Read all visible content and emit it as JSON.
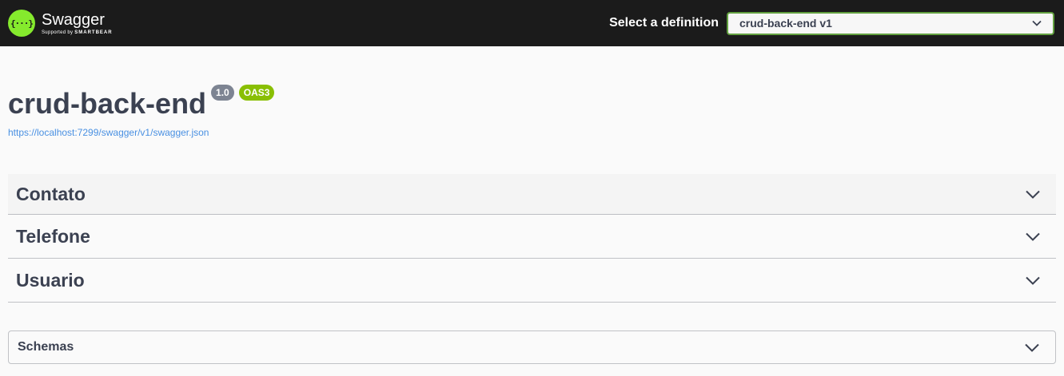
{
  "topbar": {
    "brand_name": "Swagger",
    "brand_sub_prefix": "Supported by",
    "brand_sub_name": "SMARTBEAR",
    "logo_glyph": "{···}",
    "select_label": "Select a definition",
    "selected_definition": "crud-back-end v1"
  },
  "info": {
    "title": "crud-back-end",
    "version": "1.0",
    "oas_badge": "OAS3",
    "spec_url": "https://localhost:7299/swagger/v1/swagger.json"
  },
  "tags": [
    {
      "name": "Contato"
    },
    {
      "name": "Telefone"
    },
    {
      "name": "Usuario"
    }
  ],
  "schemas": {
    "title": "Schemas"
  },
  "colors": {
    "topbar_bg": "#1b1b1b",
    "logo_green": "#85ea2d",
    "select_border": "#62a03f",
    "version_badge": "#7d8492",
    "oas_badge": "#89bf04",
    "link": "#4990e2"
  }
}
